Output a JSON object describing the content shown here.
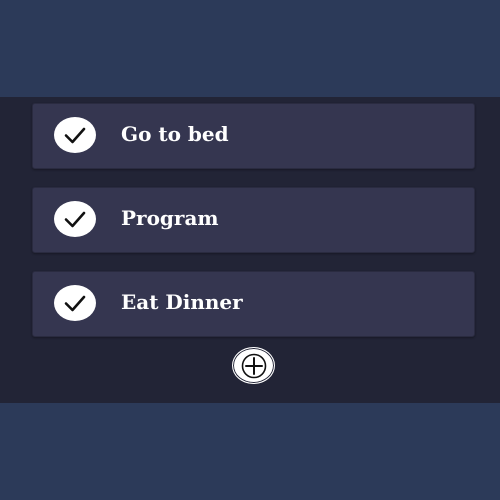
{
  "tasks": [
    {
      "label": "Go to bed",
      "done": true
    },
    {
      "label": "Program",
      "done": true
    },
    {
      "label": "Eat Dinner",
      "done": true
    }
  ],
  "icons": {
    "task_status": "check-icon",
    "add": "plus-icon"
  },
  "colors": {
    "page_background": "#2c3a59",
    "panel_background": "#222436",
    "task_card": "#353650",
    "text": "#ffffff",
    "icon_fill": "#ffffff"
  }
}
